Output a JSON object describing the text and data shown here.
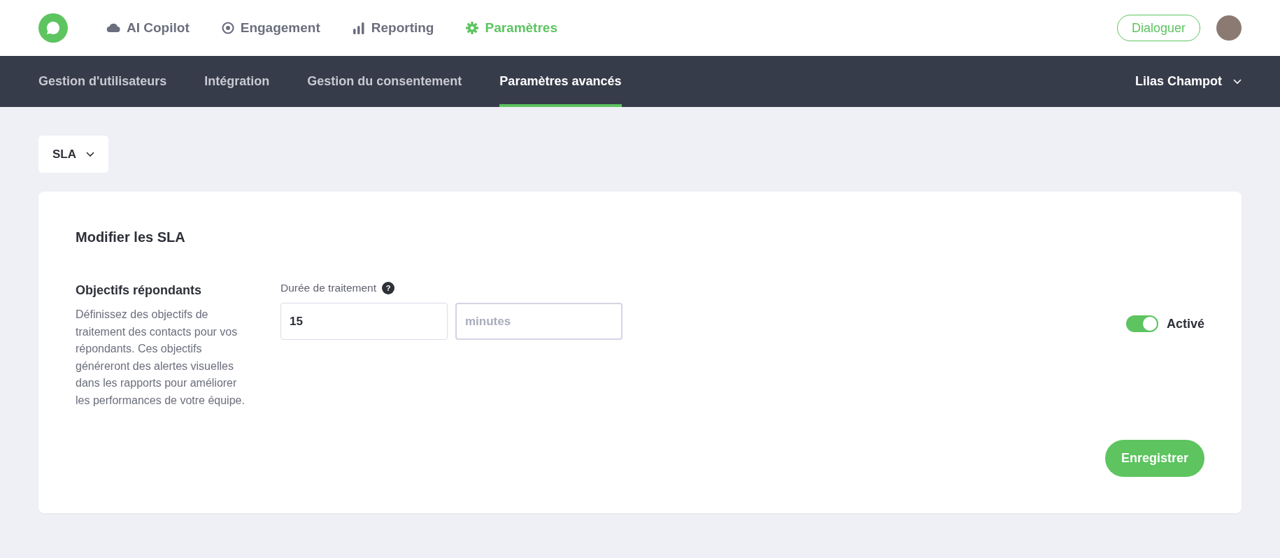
{
  "top_nav": [
    {
      "label": "AI Copilot",
      "kind": "cloud",
      "selected": false
    },
    {
      "label": "Engagement",
      "kind": "target",
      "selected": false
    },
    {
      "label": "Reporting",
      "kind": "bars",
      "selected": false
    },
    {
      "label": "Paramètres",
      "kind": "gear",
      "selected": true
    }
  ],
  "chat_button": "Dialoguer",
  "sub_nav": [
    {
      "label": "Gestion d'utilisateurs",
      "selected": false
    },
    {
      "label": "Intégration",
      "selected": false
    },
    {
      "label": "Gestion du consentement",
      "selected": false
    },
    {
      "label": "Paramètres avancés",
      "selected": true
    }
  ],
  "user_menu": "Lilas Champot",
  "section_dropdown": "SLA",
  "card": {
    "title": "Modifier les SLA",
    "section_title": "Objectifs répondants",
    "description": "Définissez des objectifs de traitement des contacts pour vos répondants. Ces objectifs généreront des alertes visuelles dans les rapports pour améliorer les performances de votre équipe.",
    "field_label": "Durée de traitement",
    "help_mark": "?",
    "value": "15",
    "unit_placeholder": "minutes",
    "toggle": {
      "label": "Activé",
      "on": true
    },
    "save_button": "Enregistrer"
  }
}
